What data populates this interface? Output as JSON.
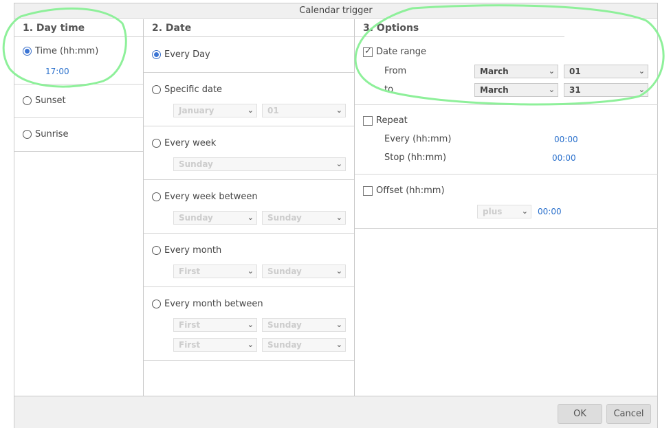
{
  "window": {
    "title": "Calendar trigger"
  },
  "day_time": {
    "header": "1. Day time",
    "time_label": "Time (hh:mm)",
    "time_value": "17:00",
    "sunset_label": "Sunset",
    "sunrise_label": "Sunrise"
  },
  "date": {
    "header": "2. Date",
    "every_day": "Every Day",
    "specific_date": {
      "label": "Specific date",
      "month": "January",
      "day": "01"
    },
    "every_week": {
      "label": "Every week",
      "weekday": "Sunday"
    },
    "every_week_between": {
      "label": "Every week between",
      "from": "Sunday",
      "to": "Sunday"
    },
    "every_month": {
      "label": "Every month",
      "ordinal": "First",
      "weekday": "Sunday"
    },
    "every_month_between": {
      "label": "Every month between",
      "from_ordinal": "First",
      "from_weekday": "Sunday",
      "to_ordinal": "First",
      "to_weekday": "Sunday"
    }
  },
  "options": {
    "header": "3. Options",
    "date_range": {
      "label": "Date range",
      "from_label": "From",
      "from_month": "March",
      "from_day": "01",
      "to_label": "to",
      "to_month": "March",
      "to_day": "31"
    },
    "repeat": {
      "label": "Repeat",
      "every_label": "Every (hh:mm)",
      "every_value": "00:00",
      "stop_label": "Stop (hh:mm)",
      "stop_value": "00:00"
    },
    "offset": {
      "label": "Offset (hh:mm)",
      "sign": "plus",
      "value": "00:00"
    }
  },
  "footer": {
    "ok_label": "OK",
    "cancel_label": "Cancel"
  },
  "colors": {
    "accent": "#2a70cc",
    "annotation": "#8ef09a"
  }
}
